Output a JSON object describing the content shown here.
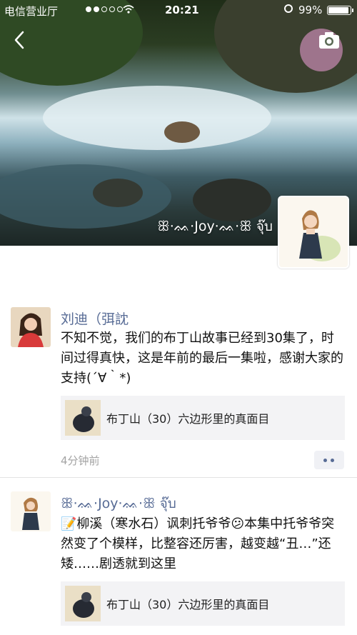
{
  "status": {
    "carrier": "电信营业厅",
    "time": "20:21",
    "battery": "99%"
  },
  "profile": {
    "name": "ꕥ·ᨐ·Joy·ᨐ·ꕥ จุ๊บ"
  },
  "posts": [
    {
      "name": "刘迪（弭訦",
      "text": "不知不觉，我们的布丁山故事已经到30集了，时间过得真快，这是年前的最后一集啦，感谢大家的支持(´∀｀*)",
      "link_title": "布丁山（30）六边形里的真面目",
      "time": "4分钟前"
    },
    {
      "name": "ꕥ·ᨐ·Joy·ᨐ·ꕥ จุ๊บ",
      "text": "📝柳溪（寒水石）讽刺托爷爷😕本集中托爷爷突然变了个模样，比整容还厉害，越变越“丑…”还矮……剧透就到这里",
      "link_title": "布丁山（30）六边形里的真面目"
    }
  ],
  "colors": {
    "link_name": "#576b95",
    "time_gray": "#a3a3a3",
    "card_bg": "#f3f3f5"
  },
  "icons": [
    "back-arrow-icon",
    "camera-icon",
    "comment-dots-icon",
    "wifi-icon",
    "battery-icon"
  ]
}
